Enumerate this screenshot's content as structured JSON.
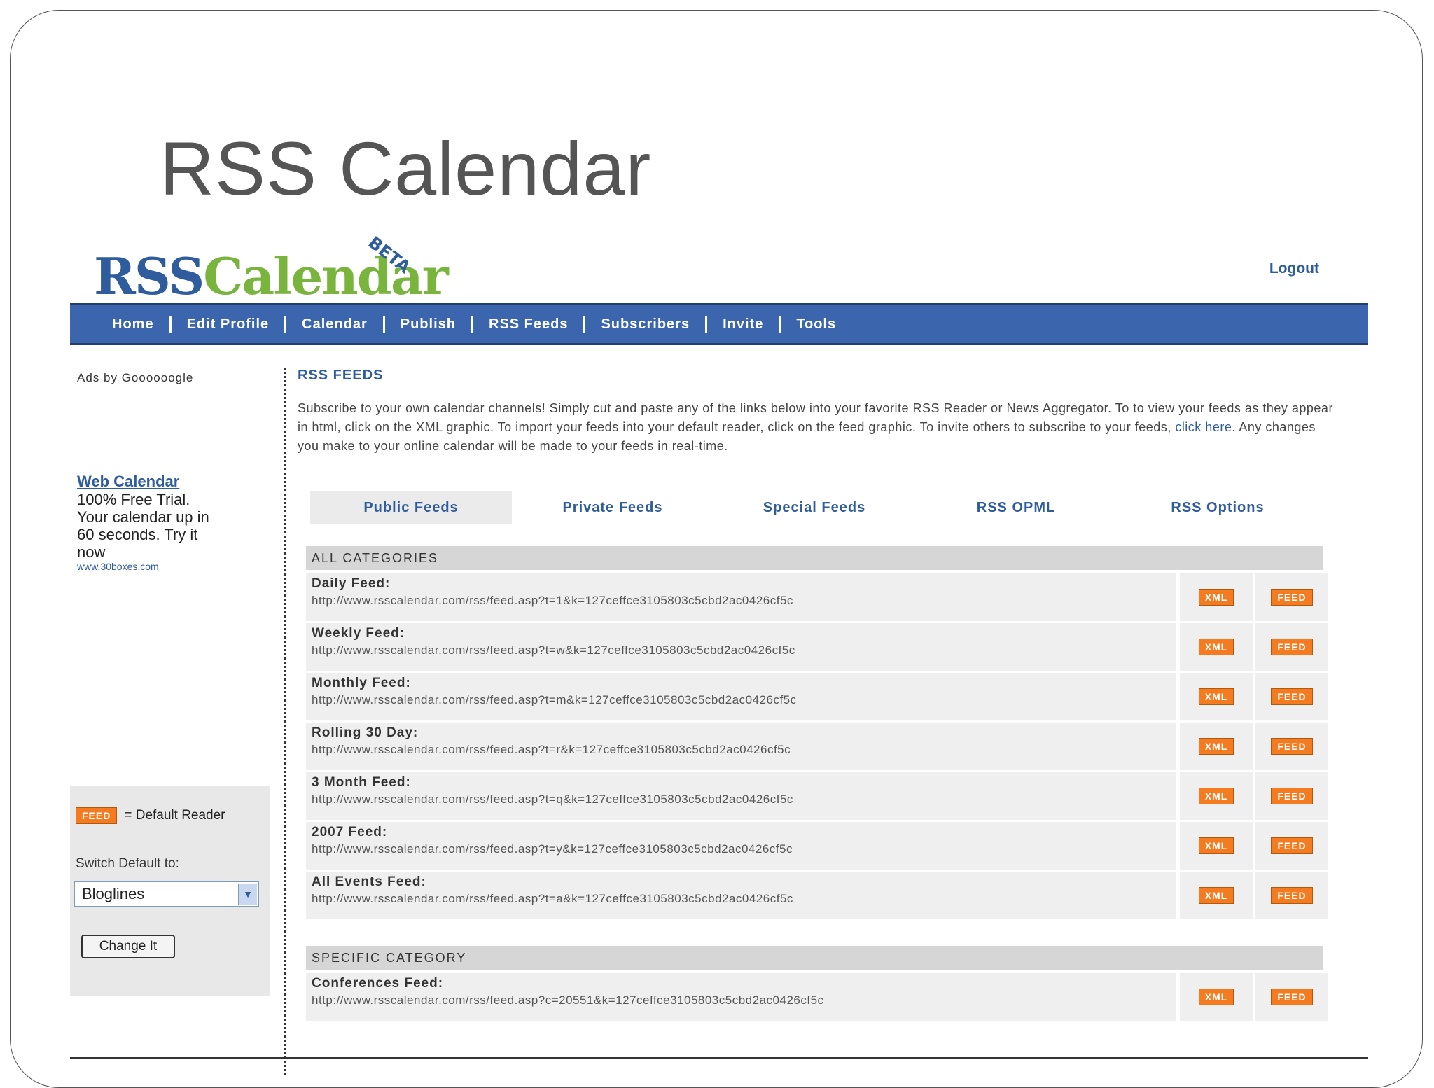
{
  "slide": {
    "title": "RSS Calendar"
  },
  "app": {
    "logo_rss": "RSS",
    "logo_calendar": "Calendar",
    "logo_badge": "BETA",
    "logout": "Logout"
  },
  "nav": {
    "items": [
      {
        "label": "Home"
      },
      {
        "label": "Edit Profile"
      },
      {
        "label": "Calendar"
      },
      {
        "label": "Publish"
      },
      {
        "label": "RSS Feeds"
      },
      {
        "label": "Subscribers"
      },
      {
        "label": "Invite"
      },
      {
        "label": "Tools"
      }
    ]
  },
  "sidebar": {
    "ads_by": "Ads by Goooooogle",
    "ad_title": "Web Calendar",
    "ad_body": "100% Free Trial. Your calendar up in 60 seconds. Try it now",
    "ad_url": "www.30boxes.com",
    "default_reader_badge": "FEED",
    "default_reader_text": "= Default Reader",
    "switch_label": "Switch Default to:",
    "reader_select": "Bloglines",
    "change_button": "Change It"
  },
  "main": {
    "heading": "RSS FEEDS",
    "intro": "Subscribe to your own calendar channels! Simply cut and paste any of the links below into your favorite RSS Reader or News Aggregator. To to view your feeds as they appear in html, click on the XML graphic. To import your feeds into your default reader, click on the feed graphic. To invite others to subscribe to your feeds,",
    "intro_link": "click here",
    "intro_tail": ". Any changes you make to your online calendar will be made to your feeds in real-time.",
    "tabs": [
      {
        "label": "Public Feeds"
      },
      {
        "label": "Private Feeds"
      },
      {
        "label": "Special Feeds"
      },
      {
        "label": "RSS OPML"
      },
      {
        "label": "RSS Options"
      }
    ],
    "all_categories": {
      "heading": "ALL CATEGORIES",
      "feeds": [
        {
          "name": "Daily Feed:",
          "url": "http://www.rsscalendar.com/rss/feed.asp?t=1&k=127ceffce3105803c5cbd2ac0426cf5c"
        },
        {
          "name": "Weekly Feed:",
          "url": "http://www.rsscalendar.com/rss/feed.asp?t=w&k=127ceffce3105803c5cbd2ac0426cf5c"
        },
        {
          "name": "Monthly Feed:",
          "url": "http://www.rsscalendar.com/rss/feed.asp?t=m&k=127ceffce3105803c5cbd2ac0426cf5c"
        },
        {
          "name": "Rolling 30 Day:",
          "url": "http://www.rsscalendar.com/rss/feed.asp?t=r&k=127ceffce3105803c5cbd2ac0426cf5c"
        },
        {
          "name": "3 Month Feed:",
          "url": "http://www.rsscalendar.com/rss/feed.asp?t=q&k=127ceffce3105803c5cbd2ac0426cf5c"
        },
        {
          "name": "2007 Feed:",
          "url": "http://www.rsscalendar.com/rss/feed.asp?t=y&k=127ceffce3105803c5cbd2ac0426cf5c"
        },
        {
          "name": "All Events Feed:",
          "url": "http://www.rsscalendar.com/rss/feed.asp?t=a&k=127ceffce3105803c5cbd2ac0426cf5c"
        }
      ]
    },
    "specific_category": {
      "heading": "SPECIFIC CATEGORY",
      "feeds": [
        {
          "name": "Conferences Feed:",
          "url": "http://www.rsscalendar.com/rss/feed.asp?c=20551&k=127ceffce3105803c5cbd2ac0426cf5c"
        }
      ]
    },
    "xml_badge": "XML",
    "feed_badge": "FEED"
  },
  "colors": {
    "nav_bg": "#3b66ae",
    "link": "#2f5c9c",
    "logo_green": "#79b43c",
    "badge_orange": "#f47b20"
  }
}
